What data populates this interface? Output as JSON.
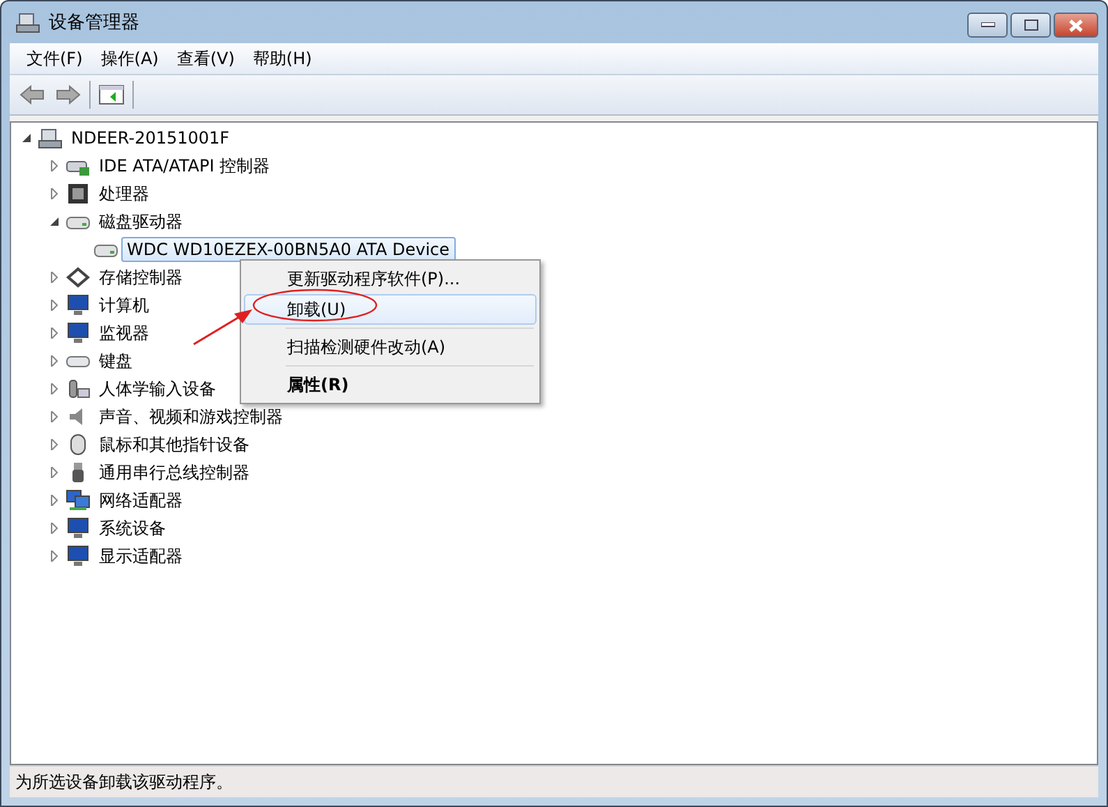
{
  "window": {
    "title": "设备管理器"
  },
  "menu_bar": [
    "文件(F)",
    "操作(A)",
    "查看(V)",
    "帮助(H)"
  ],
  "tree": {
    "label": "NDEER-20151001F",
    "kind": "computer",
    "expanded": true,
    "children": [
      {
        "label": "IDE ATA/ATAPI 控制器",
        "kind": "ide",
        "expanded": false
      },
      {
        "label": "处理器",
        "kind": "cpu",
        "expanded": false
      },
      {
        "label": "磁盘驱动器",
        "kind": "disk",
        "expanded": true,
        "children": [
          {
            "label": "WDC WD10EZEX-00BN5A0 ATA Device",
            "kind": "disk",
            "selected": true
          }
        ]
      },
      {
        "label": "存储控制器",
        "kind": "storage",
        "expanded": false
      },
      {
        "label": "计算机",
        "kind": "monitor",
        "expanded": false
      },
      {
        "label": "监视器",
        "kind": "monitor",
        "expanded": false
      },
      {
        "label": "键盘",
        "kind": "keyboard",
        "expanded": false
      },
      {
        "label": "人体学输入设备",
        "kind": "hid",
        "expanded": false
      },
      {
        "label": "声音、视频和游戏控制器",
        "kind": "speaker",
        "expanded": false
      },
      {
        "label": "鼠标和其他指针设备",
        "kind": "mouse",
        "expanded": false
      },
      {
        "label": "通用串行总线控制器",
        "kind": "usb",
        "expanded": false
      },
      {
        "label": "网络适配器",
        "kind": "network",
        "expanded": false
      },
      {
        "label": "系统设备",
        "kind": "monitor",
        "expanded": false
      },
      {
        "label": "显示适配器",
        "kind": "monitor",
        "expanded": false
      }
    ]
  },
  "context_menu": [
    {
      "kind": "item",
      "label": "更新驱动程序软件(P)...",
      "selected": false,
      "bold": false
    },
    {
      "kind": "item",
      "label": "卸载(U)",
      "selected": true,
      "bold": false
    },
    {
      "kind": "separator"
    },
    {
      "kind": "item",
      "label": "扫描检测硬件改动(A)",
      "selected": false,
      "bold": false
    },
    {
      "kind": "separator"
    },
    {
      "kind": "item",
      "label": "属性(R)",
      "selected": false,
      "bold": true
    }
  ],
  "status_bar": "为所选设备卸载该驱动程序。"
}
